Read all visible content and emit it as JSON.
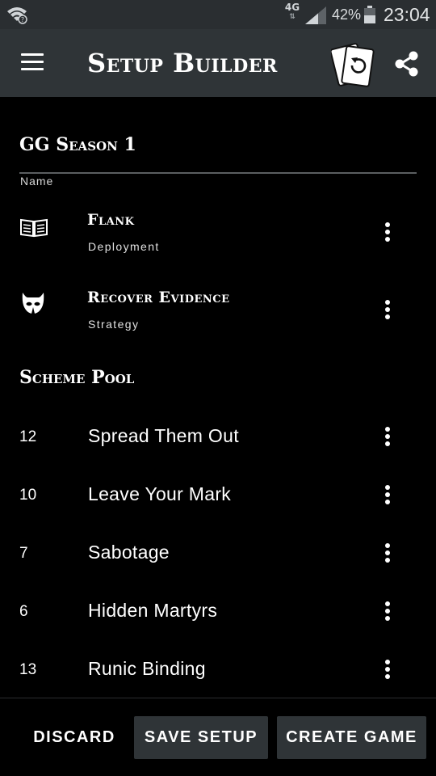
{
  "status_bar": {
    "network": "4G",
    "battery_percent": "42%",
    "time": "23:04",
    "icons": [
      "wifi-icon",
      "signal-icon",
      "battery-icon"
    ]
  },
  "app_bar": {
    "title": "Setup Builder",
    "icons": [
      "menu-icon",
      "reset-cards-icon",
      "share-icon"
    ]
  },
  "setup": {
    "name": "GG Season 1",
    "name_label": "Name"
  },
  "deployment": [
    {
      "title": "Flank",
      "subtitle": "Deployment",
      "icon": "book-icon"
    },
    {
      "title": "Recover Evidence",
      "subtitle": "Strategy",
      "icon": "mask-icon"
    }
  ],
  "scheme_pool": {
    "title": "Scheme Pool",
    "items": [
      {
        "number": "12",
        "name": "Spread Them Out"
      },
      {
        "number": "10",
        "name": "Leave Your Mark"
      },
      {
        "number": "7",
        "name": "Sabotage"
      },
      {
        "number": "6",
        "name": "Hidden Martyrs"
      },
      {
        "number": "13",
        "name": "Runic Binding"
      }
    ]
  },
  "actions": {
    "discard": "DISCARD",
    "save": "SAVE SETUP",
    "create": "CREATE GAME"
  }
}
